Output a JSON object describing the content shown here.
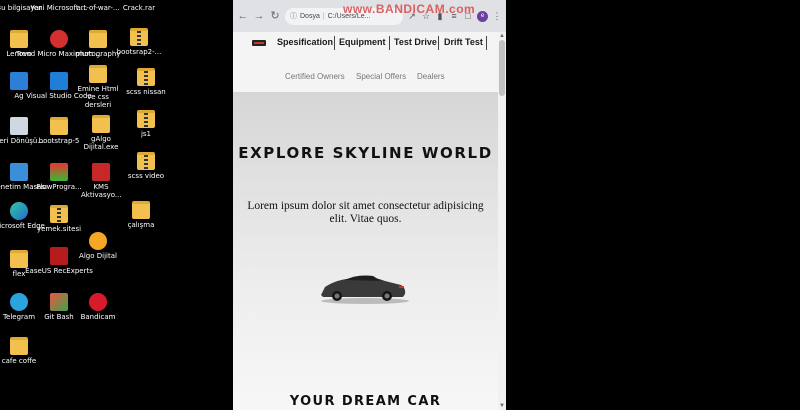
{
  "desktop": {
    "icons": [
      {
        "label": "Bu bilgisayar"
      },
      {
        "label": "Yeni Microsoft ..."
      },
      {
        "label": "art-of-war-..."
      },
      {
        "label": "Crack.rar"
      },
      {
        "label": "Lenovo"
      },
      {
        "label": "Trend Micro Maximum ..."
      },
      {
        "label": "photography"
      },
      {
        "label": "bootsrap2-..."
      },
      {
        "label": "Ag"
      },
      {
        "label": "Visual Studio Code"
      },
      {
        "label": "Emine Html ve css dersleri"
      },
      {
        "label": "scss nissan"
      },
      {
        "label": "Geri Dönüşü..."
      },
      {
        "label": "bootstrap-5"
      },
      {
        "label": "gAlgo Dijital.exe"
      },
      {
        "label": "js1"
      },
      {
        "label": "Denetim Masası"
      },
      {
        "label": "FlowProgra..."
      },
      {
        "label": "KMS Aktivasyo..."
      },
      {
        "label": "scss video"
      },
      {
        "label": "Microsoft Edge"
      },
      {
        "label": "yemek.sitesi"
      },
      {
        "label": "çalışma"
      },
      {
        "label": "flex"
      },
      {
        "label": "EaseUS RecExperts"
      },
      {
        "label": "Algo Dijital"
      },
      {
        "label": "Telegram"
      },
      {
        "label": "Git Bash"
      },
      {
        "label": "Bandicam"
      },
      {
        "label": "cafe coffe"
      }
    ]
  },
  "browser": {
    "watermark": "www.BANDICAM.com",
    "address": {
      "prefix": "Dosya",
      "path": "C:/Users/Le..."
    },
    "avatar_letter": "e"
  },
  "page": {
    "nav": {
      "links": [
        "Spesification",
        "Equipment",
        "Test Drive",
        "Drift Test"
      ],
      "sublinks": [
        "Certified Owners",
        "Special Offers",
        "Dealers"
      ]
    },
    "hero": {
      "title": "EXPLORE SKYLINE WORLD",
      "text": "Lorem ipsum dolor sit amet consectetur adipisicing elit. Vitae quos.",
      "next_heading": "YOUR DREAM CAR"
    }
  },
  "colors": {
    "watermark": "#d84a4a",
    "avatar": "#6b3fa0",
    "folder": "#f2c04e"
  }
}
